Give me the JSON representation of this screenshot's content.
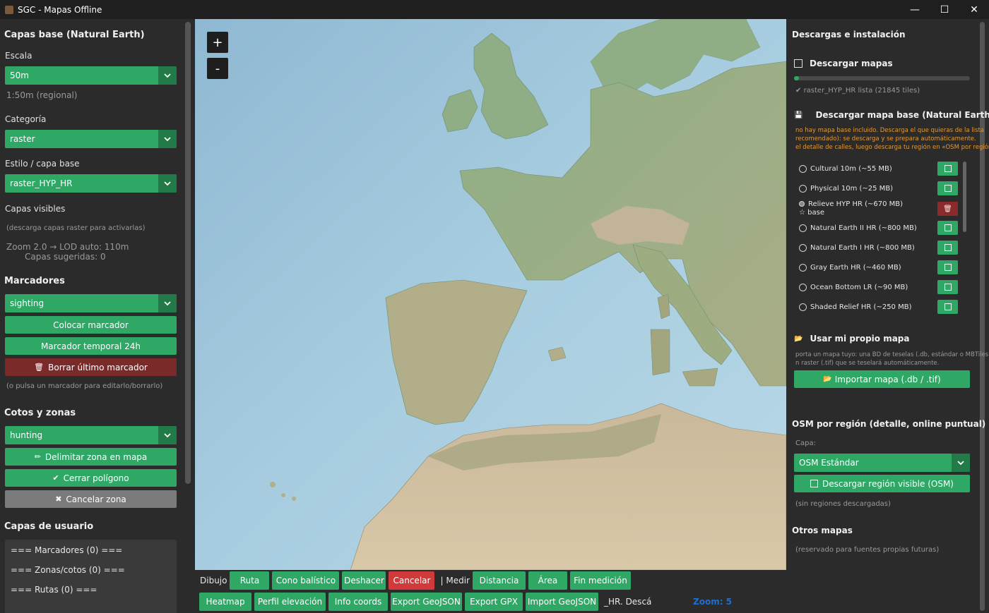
{
  "window": {
    "title": "SGC - Mapas Offline",
    "minimize": "—",
    "maximize": "☐",
    "close": "✕"
  },
  "left": {
    "base_layers_title": "Capas base (Natural Earth)",
    "scale_label": "Escala",
    "scale_value": "50m",
    "scale_hint": "1:50m (regional)",
    "category_label": "Categoría",
    "category_value": "raster",
    "style_label": "Estilo / capa base",
    "style_value": "raster_HYP_HR",
    "visible_layers_label": "Capas visibles",
    "visible_layers_hint": "(descarga capas raster para activarlas)",
    "zoom_info": "Zoom 2.0 → LOD auto: 110m",
    "suggested_layers": "Capas sugeridas: 0",
    "markers_title": "Marcadores",
    "marker_type": "sighting",
    "place_marker": "Colocar marcador",
    "temp_marker": "Marcador temporal 24h",
    "delete_last_marker": "Borrar último marcador",
    "marker_hint": "(o pulsa un marcador para editarlo/borrarlo)",
    "zones_title": "Cotos y zonas",
    "zone_type": "hunting",
    "delimit_zone": "Delimitar zona en mapa",
    "close_polygon": "Cerrar polígono",
    "cancel_zone": "Cancelar zona",
    "user_layers_title": "Capas de usuario",
    "user_layers": [
      "=== Marcadores (0) ===",
      "=== Zonas/cotos (0) ===",
      "=== Rutas (0) ==="
    ]
  },
  "map": {
    "zoom_in": "+",
    "zoom_out": "-"
  },
  "toolbar": {
    "draw_label": "Dibujo",
    "route": "Ruta",
    "ballistic_cone": "Cono balístico",
    "undo": "Deshacer",
    "cancel": "Cancelar",
    "measure_label": "| Medir",
    "distance": "Distancia",
    "area": "Área",
    "end_measure": "Fin medición",
    "heatmap": "Heatmap",
    "elevation_profile": "Perfil elevación",
    "coords_info": "Info coords",
    "export_geojson": "Export GeoJSON",
    "export_gpx": "Export GPX",
    "import_geojson": "Import GeoJSON",
    "status_text": "_HR. Descá",
    "zoom_text": "Zoom: 5"
  },
  "right": {
    "downloads_title": "Descargas e instalación",
    "download_maps": "Descargar mapas",
    "progress_percent": 3,
    "raster_ready": "raster_HYP_HR lista (21845 tiles)",
    "download_base": "Descargar mapa base (Natural Earth)",
    "warn_lines": [
      "no hay mapa base incluido. Descarga el que quieras de la lista",
      "recomendado): se descarga y se prepara automáticamente.",
      "el detalle de calles, luego descarga tu región en «OSM por región»"
    ],
    "base_maps": [
      {
        "label": "Cultural 10m (~55 MB)",
        "action": "download"
      },
      {
        "label": "Physical 10m (~25 MB)",
        "action": "download"
      },
      {
        "label": "Relieve HYP HR (~670 MB)",
        "sub": "☆ base",
        "action": "delete"
      },
      {
        "label": "Natural Earth II HR (~800 MB)",
        "action": "download"
      },
      {
        "label": "Natural Earth I HR (~800 MB)",
        "action": "download"
      },
      {
        "label": "Gray Earth HR (~460 MB)",
        "action": "download"
      },
      {
        "label": "Ocean Bottom LR (~90 MB)",
        "action": "download"
      },
      {
        "label": "Shaded Relief HR (~250 MB)",
        "action": "download"
      }
    ],
    "own_map_title": "Usar mi propio mapa",
    "own_map_hint1": "porta un mapa tuyo: una BD de teselas (.db, estándar o MBTiles",
    "own_map_hint2": "n raster (.tif) que se teselará automáticamente.",
    "import_map": "Importar mapa (.db / .tif)",
    "osm_title": "OSM por región (detalle, online puntual)",
    "osm_layer_label": "Capa:",
    "osm_layer_value": "OSM Estándar",
    "download_visible_region": "Descargar región visible (OSM)",
    "no_regions": "(sin regiones descargadas)",
    "other_maps_title": "Otros mapas",
    "other_maps_hint": "(reservado para fuentes propias futuras)"
  }
}
